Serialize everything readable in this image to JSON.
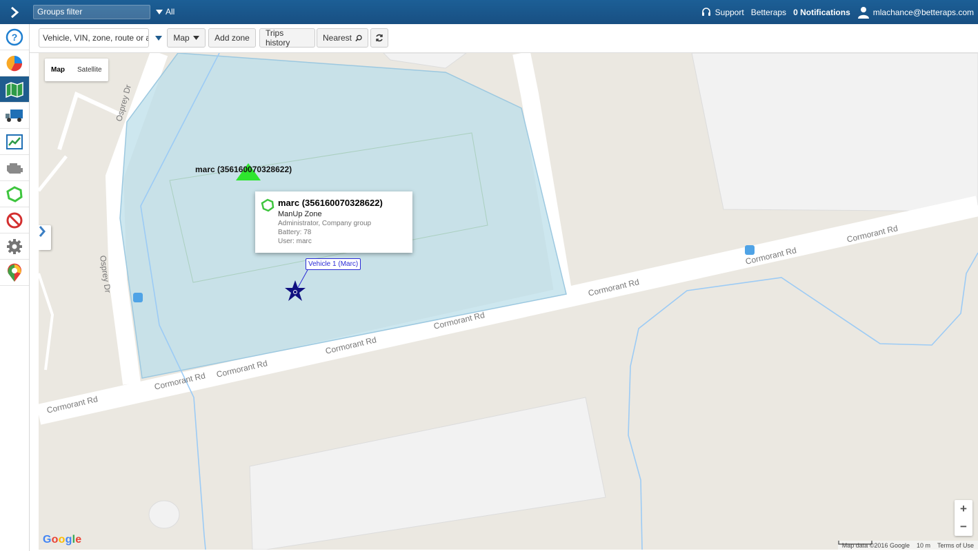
{
  "topbar": {
    "groups_filter_value": "Groups filter",
    "groups_all": "All",
    "support": "Support",
    "company": "Betteraps",
    "notifications": "0 Notifications",
    "user_email": "mlachance@betteraps.com"
  },
  "sidebar": {
    "items": [
      {
        "icon": "help-icon"
      },
      {
        "icon": "pie-chart-icon"
      },
      {
        "icon": "map-icon",
        "active": true
      },
      {
        "icon": "truck-icon"
      },
      {
        "icon": "report-chart-icon"
      },
      {
        "icon": "engine-icon"
      },
      {
        "icon": "zone-icon"
      },
      {
        "icon": "forbidden-icon"
      },
      {
        "icon": "gear-icon"
      },
      {
        "icon": "map-pin-icon"
      }
    ]
  },
  "toolbar": {
    "search_placeholder": "Vehicle, VIN, zone, route or address",
    "map_label": "Map",
    "add_zone_label": "Add zone",
    "trips_history_label": "Trips history",
    "nearest_label": "Nearest"
  },
  "map": {
    "type_map": "Map",
    "type_satellite": "Satellite",
    "device_label": "marc (356160070328622)",
    "vehicle_label": "Vehicle 1 (Marc)",
    "popup": {
      "title": "marc (356160070328622)",
      "zone": "ManUp Zone",
      "group": "Administrator, Company group",
      "battery": "Battery: 78",
      "user": "User: marc"
    },
    "roads": {
      "osprey_1": "Osprey Dr",
      "osprey_2": "Osprey Dr",
      "cormorant_1": "Cormorant Rd",
      "cormorant_2": "Cormorant Rd",
      "cormorant_3": "Cormorant Rd",
      "cormorant_4": "Cormorant Rd",
      "cormorant_5": "Cormorant Rd",
      "cormorant_6": "Cormorant Rd",
      "cormorant_7": "Cormorant Rd",
      "cormorant_8": "Cormorant Rd"
    },
    "google": "Google",
    "attribution_data": "Map data ©2016 Google",
    "scale": "10 m",
    "terms": "Terms of Use",
    "zoom_in": "+",
    "zoom_out": "−"
  },
  "colors": {
    "topbar": "#1c5f96",
    "zone_fill": "#c5e1ea",
    "device_marker": "#2ee62e",
    "vehicle_marker": "#101080"
  }
}
